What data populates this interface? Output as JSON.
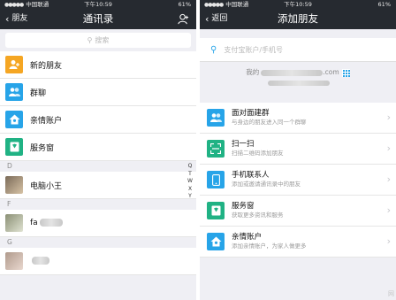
{
  "colors": {
    "navbar": "#262a30",
    "orange": "#f5a623",
    "blue": "#27a4e8",
    "accent": "#27a4e8"
  },
  "left": {
    "status": {
      "carrier": "中国联通",
      "time": "下午10:59",
      "battery": "61%"
    },
    "nav": {
      "back": "朋友",
      "title": "通讯录"
    },
    "search_placeholder": "搜索",
    "menu": [
      {
        "label": "新的朋友",
        "icon": "new-friend-icon"
      },
      {
        "label": "群聊",
        "icon": "group-chat-icon"
      },
      {
        "label": "亲情账户",
        "icon": "family-account-icon"
      },
      {
        "label": "服务窗",
        "icon": "service-window-icon"
      }
    ],
    "sections": [
      {
        "letter": "D",
        "contact": "电脑小王"
      },
      {
        "letter": "F",
        "contact": "fa"
      },
      {
        "letter": "G",
        "contact": ""
      }
    ],
    "index": [
      "Q",
      "T",
      "W",
      "X",
      "Y"
    ]
  },
  "right": {
    "status": {
      "carrier": "中国联通",
      "time": "下午10:59",
      "battery": "61%"
    },
    "nav": {
      "back": "返回",
      "title": "添加朋友"
    },
    "search_placeholder": "支付宝账户/手机号",
    "my_account_prefix": "我的",
    "my_account_suffix": ".com",
    "options": [
      {
        "title": "面对面建群",
        "subtitle": "与身边的朋友进入同一个群聊",
        "icon": "face-to-face-icon"
      },
      {
        "title": "扫一扫",
        "subtitle": "扫描二维码添加朋友",
        "icon": "scan-icon"
      },
      {
        "title": "手机联系人",
        "subtitle": "添加或邀请通讯录中的朋友",
        "icon": "phone-contacts-icon"
      },
      {
        "title": "服务窗",
        "subtitle": "获取更多资讯和服务",
        "icon": "service-window-icon"
      },
      {
        "title": "亲情账户",
        "subtitle": "添加亲情账户，为家人做更多",
        "icon": "family-account-icon"
      }
    ],
    "watermark": "网"
  }
}
